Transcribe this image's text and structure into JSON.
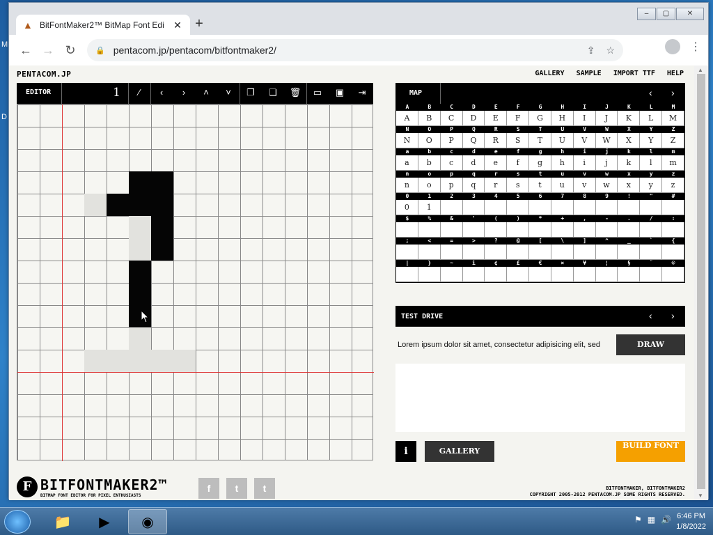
{
  "browser": {
    "tab_title": "BitFontMaker2™ BitMap Font Edi",
    "url": "pentacom.jp/pentacom/bitfontmaker2/"
  },
  "site": {
    "brand": "PENTACOM.JP",
    "nav": [
      "GALLERY",
      "SAMPLE",
      "IMPORT TTF",
      "HELP"
    ]
  },
  "editor": {
    "label": "EDITOR",
    "glyph": "1"
  },
  "map": {
    "label": "MAP",
    "rows": [
      {
        "headers": [
          "A",
          "B",
          "C",
          "D",
          "E",
          "F",
          "G",
          "H",
          "I",
          "J",
          "K",
          "L",
          "M"
        ],
        "cells": [
          "A",
          "B",
          "C",
          "D",
          "E",
          "F",
          "G",
          "H",
          "I",
          "J",
          "K",
          "L",
          "M"
        ]
      },
      {
        "headers": [
          "N",
          "O",
          "P",
          "Q",
          "R",
          "S",
          "T",
          "U",
          "V",
          "W",
          "X",
          "Y",
          "Z"
        ],
        "cells": [
          "N",
          "O",
          "P",
          "Q",
          "R",
          "S",
          "T",
          "U",
          "V",
          "W",
          "X",
          "Y",
          "Z"
        ]
      },
      {
        "headers": [
          "a",
          "b",
          "c",
          "d",
          "e",
          "f",
          "g",
          "h",
          "i",
          "j",
          "k",
          "l",
          "m"
        ],
        "cells": [
          "a",
          "b",
          "c",
          "d",
          "e",
          "f",
          "g",
          "h",
          "i",
          "j",
          "k",
          "l",
          "m"
        ]
      },
      {
        "headers": [
          "n",
          "o",
          "p",
          "q",
          "r",
          "s",
          "t",
          "u",
          "v",
          "w",
          "x",
          "y",
          "z"
        ],
        "cells": [
          "n",
          "o",
          "p",
          "q",
          "r",
          "s",
          "t",
          "u",
          "v",
          "w",
          "x",
          "y",
          "z"
        ]
      },
      {
        "headers": [
          "0",
          "1",
          "2",
          "3",
          "4",
          "5",
          "6",
          "7",
          "8",
          "9",
          "!",
          "\"",
          "#"
        ],
        "cells": [
          "0",
          "1",
          "",
          "",
          "",
          "",
          "",
          "",
          "",
          "",
          "",
          "",
          ""
        ]
      },
      {
        "headers": [
          "$",
          "%",
          "&",
          "'",
          "(",
          ")",
          "*",
          "+",
          ",",
          "-",
          ".",
          "/",
          ":"
        ],
        "cells": [
          "",
          "",
          "",
          "",
          "",
          "",
          "",
          "",
          "",
          "",
          "",
          "",
          ""
        ]
      },
      {
        "headers": [
          ";",
          "<",
          "=",
          ">",
          "?",
          "@",
          "[",
          "\\",
          "]",
          "^",
          "_",
          "`",
          "{"
        ],
        "cells": [
          "",
          "",
          "",
          "",
          "",
          "",
          "",
          "",
          "",
          "",
          "",
          "",
          ""
        ]
      },
      {
        "headers": [
          "|",
          "}",
          "~",
          "i",
          "¢",
          "£",
          "€",
          "×",
          "¥",
          "¦",
          "§",
          "¨",
          "©"
        ],
        "cells": [
          "",
          "",
          "",
          "",
          "",
          "",
          "",
          "",
          "",
          "",
          "",
          "",
          ""
        ]
      }
    ]
  },
  "test_drive": {
    "label": "TEST DRIVE",
    "text": "Lorem ipsum dolor sit amet, consectetur adipisicing elit, sed",
    "draw_label": "DRAW"
  },
  "actions": {
    "info_label": "i",
    "gallery_label": "GALLERY",
    "build_label": "BUILD FONT"
  },
  "footer": {
    "logo_name": "BITFONTMAKER2™",
    "logo_tag": "BITMAP FONT EDITOR FOR PIXEL ENTHUSIASTS",
    "social": [
      "f",
      "t",
      "t"
    ],
    "copyright_line1": "BITFONTMAKER, BITFONTMAKER2",
    "copyright_line2": "COPYRIGHT 2005-2012 PENTACOM.JP SOME RIGHTS RESERVED."
  },
  "taskbar": {
    "time": "6:46 PM",
    "date": "1/8/2022"
  },
  "colors": {
    "accent_orange": "#f5a000",
    "guide_red": "#dd3333",
    "bar_black": "#000000"
  }
}
